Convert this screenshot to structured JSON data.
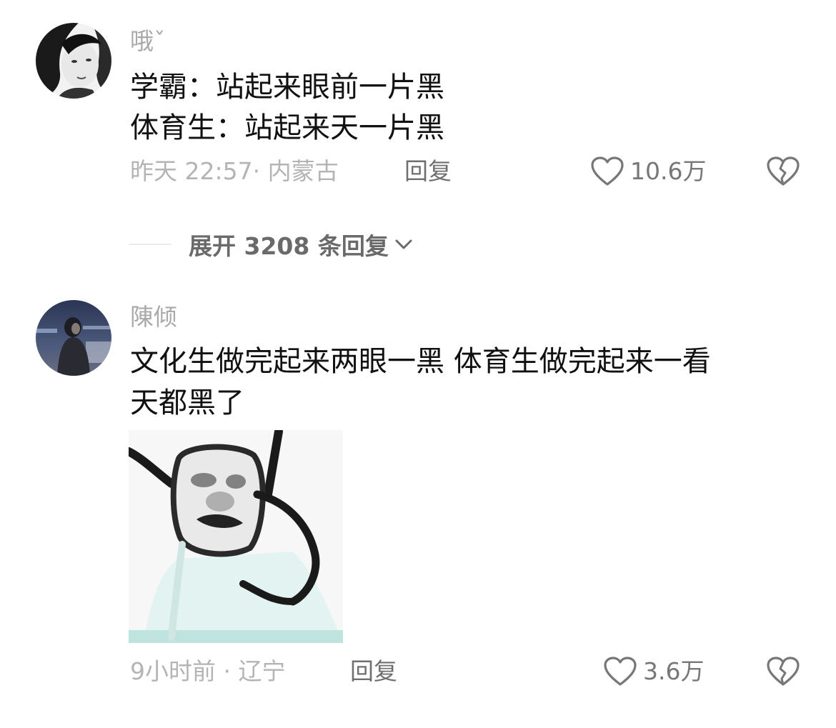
{
  "comments": [
    {
      "username": "哦ˇ",
      "lines": [
        "学霸：站起来眼前一片黑",
        "体育生：站起来天一片黑"
      ],
      "meta": "昨天 22:57· 内蒙古",
      "reply_label": "回复",
      "likes": "10.6万",
      "avatar_icon": "avatar-photo-girl"
    },
    {
      "username": "陳倾",
      "lines": [
        "文化生做完起来两眼一黑 体育生做完起来一看",
        "天都黑了"
      ],
      "meta": "9小时前 · 辽宁",
      "reply_label": "回复",
      "likes": "3.6万",
      "avatar_icon": "avatar-photo-night",
      "sticker_icon": "meme-sticker"
    }
  ],
  "expand": {
    "label": "展开 3208 条回复"
  },
  "icons": {
    "like": "heart-outline-icon",
    "dislike": "broken-heart-icon",
    "expand": "chevron-down-icon"
  },
  "colors": {
    "username": "#a9a9a9",
    "meta": "#b4b4b4",
    "text": "#111111",
    "reply": "#6f6f6f"
  }
}
